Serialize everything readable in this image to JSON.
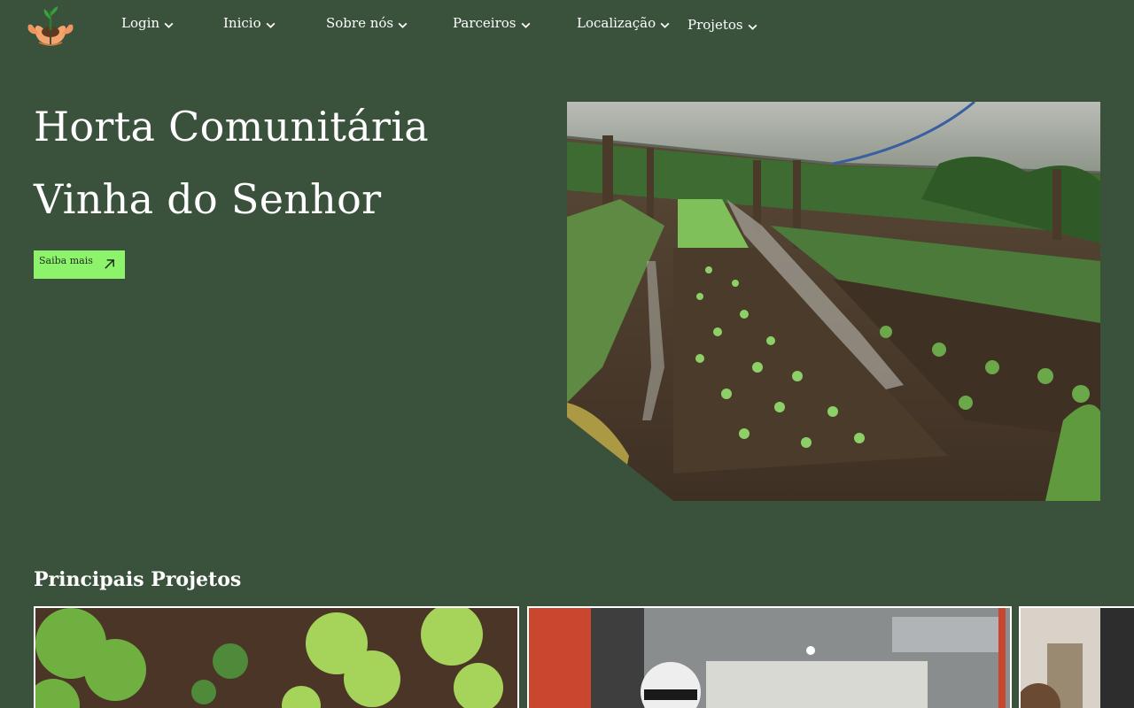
{
  "nav": {
    "logo_icon": "hands-with-plant-logo",
    "items": [
      {
        "label": "Login"
      },
      {
        "label": "Inicio"
      },
      {
        "label": "Sobre nós"
      },
      {
        "label": "Parceiros"
      },
      {
        "label": "Localização"
      },
      {
        "label": "Projetos"
      }
    ]
  },
  "hero": {
    "title_line1": "Horta Comunitária",
    "title_line2": "Vinha do Senhor",
    "cta_label": "Saiba mais",
    "cta_icon": "arrow-up-right-icon",
    "image_subject": "shade-net garden with rows of seedlings"
  },
  "projects": {
    "title": "Principais Projetos",
    "cards": [
      {
        "image_subject": "lettuce and herb seedlings in soil"
      },
      {
        "image_subject": "volunteers in hair nets in a kitchen"
      },
      {
        "image_subject": "person in a room"
      }
    ]
  },
  "colors": {
    "background": "#3a523c",
    "cta": "#8cf36a",
    "text": "#ffffff"
  }
}
